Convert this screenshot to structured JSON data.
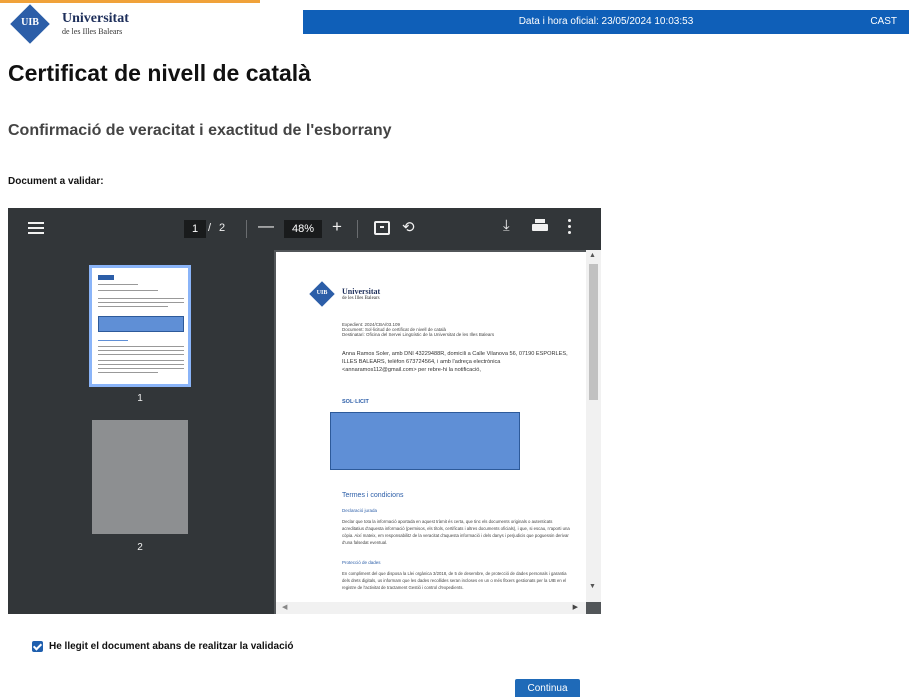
{
  "header": {
    "logo_text": "UIB",
    "university_name": "Universitat",
    "university_sub": "de les Illes Balears",
    "datetime": "Data i hora oficial: 23/05/2024 10:03:53",
    "language": "CAST"
  },
  "page": {
    "title": "Certificat de nivell de català",
    "subtitle": "Confirmació de veracitat i exactitud de l'esborrany",
    "document_label": "Document a validar:"
  },
  "viewer": {
    "current_page": "1",
    "page_separator": "/",
    "total_pages": "2",
    "zoom": "48%",
    "thumbnails": [
      {
        "label": "1"
      },
      {
        "label": "2"
      }
    ],
    "document": {
      "logo_text": "UIB",
      "university_name": "Universitat",
      "university_sub": "de les Illes Balears",
      "meta_line1": "Expedient: 2024/CBA/03.109",
      "meta_line2": "Document: Sol·licitud de certificat de nivell de català",
      "meta_line3": "Destinatari: Oficina del Servei Lingüístic de la Universitat de les Illes Balears",
      "body": "Anna Ramos Soler, amb DNI 43229488R, domicili a Calle Vilanova 56, 07190 ESPORLES, ILLES BALEARS, telèfon 673724564, i amb l'adreça electrònica <annaramos112@gmail.com> per rebre-hi la notificació,",
      "sollicit": "SOL·LICIT",
      "terms_title": "Termes i condicions",
      "section1": "Declaració jurada",
      "para1": "Declar que tota la informació aportada en aquest tràmit és certa, que tinc els documents originals o autenticats acreditatius d'aquesta informació (permisos, els títols, certificats i altres documents oficials), i que, si escau, n'aporti una còpia. Així mateix, em responsabilitz de la veracitat d'aquesta informació i dels danys i perjudicis que poguessin derivar d'una falsedat eventual.",
      "section2": "Protecció de dades",
      "para2": "En compliment del que disposa la Llei orgànica 3/2018, de 5 de desembre, de protecció de dades personals i garantia dels drets digitals, us informam que les dades recollides seran incloses en un o més fitxers gestionats per la UIB en el registre de l'activitat de tractament Gestió i control d'expedients."
    }
  },
  "confirm": {
    "checked": true,
    "label": "He llegit el document abans de realitzar la validació"
  },
  "actions": {
    "continue_label": "Continua"
  },
  "colors": {
    "topbar": "#0f5fb8",
    "accent_line": "#f0a23a",
    "brand": "#2c5ea8",
    "viewer_toolbar": "#323639",
    "button": "#1f6ab8"
  }
}
